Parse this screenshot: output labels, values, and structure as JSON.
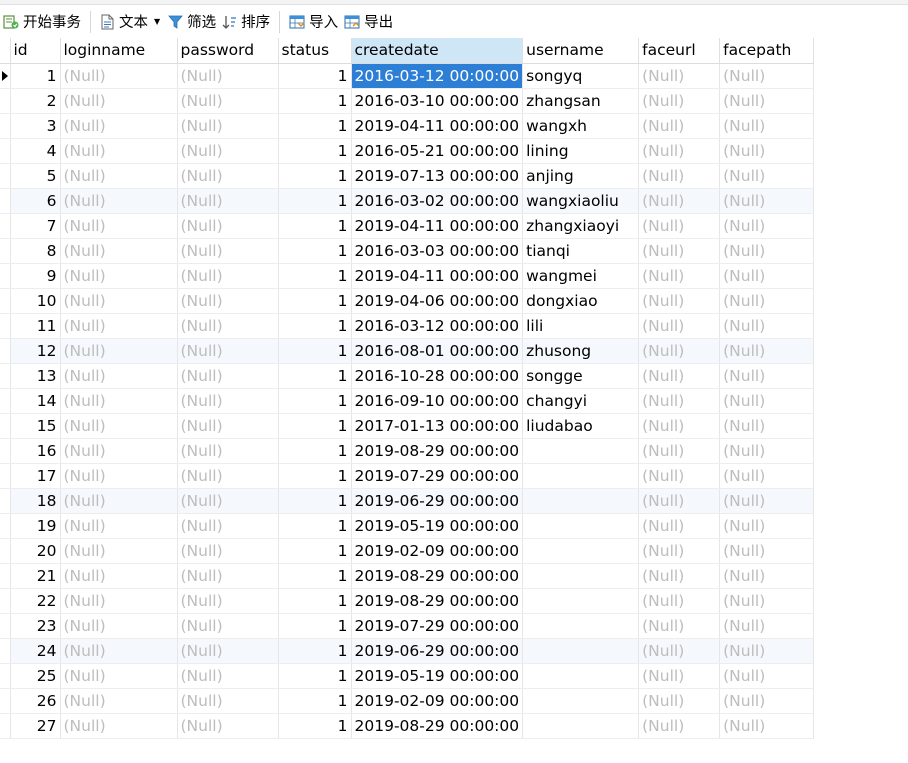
{
  "toolbar": {
    "begin_transaction": "开始事务",
    "text": "文本",
    "filter": "筛选",
    "sort": "排序",
    "import": "导入",
    "export": "导出"
  },
  "columns": [
    "id",
    "loginname",
    "password",
    "status",
    "createdate",
    "username",
    "faceurl",
    "facepath"
  ],
  "selected_column": "createdate",
  "null_text": "(Null)",
  "rows": [
    {
      "id": "1",
      "status": "1",
      "createdate": "2016-03-12 00:00:00",
      "username": "songyq"
    },
    {
      "id": "2",
      "status": "1",
      "createdate": "2016-03-10 00:00:00",
      "username": "zhangsan"
    },
    {
      "id": "3",
      "status": "1",
      "createdate": "2019-04-11 00:00:00",
      "username": "wangxh"
    },
    {
      "id": "4",
      "status": "1",
      "createdate": "2016-05-21 00:00:00",
      "username": "lining"
    },
    {
      "id": "5",
      "status": "1",
      "createdate": "2019-07-13 00:00:00",
      "username": "anjing"
    },
    {
      "id": "6",
      "status": "1",
      "createdate": "2016-03-02 00:00:00",
      "username": "wangxiaoliu"
    },
    {
      "id": "7",
      "status": "1",
      "createdate": "2019-04-11 00:00:00",
      "username": "zhangxiaoyi"
    },
    {
      "id": "8",
      "status": "1",
      "createdate": "2016-03-03 00:00:00",
      "username": "tianqi"
    },
    {
      "id": "9",
      "status": "1",
      "createdate": "2019-04-11 00:00:00",
      "username": "wangmei"
    },
    {
      "id": "10",
      "status": "1",
      "createdate": "2019-04-06 00:00:00",
      "username": "dongxiao"
    },
    {
      "id": "11",
      "status": "1",
      "createdate": "2016-03-12 00:00:00",
      "username": "lili"
    },
    {
      "id": "12",
      "status": "1",
      "createdate": "2016-08-01 00:00:00",
      "username": "zhusong"
    },
    {
      "id": "13",
      "status": "1",
      "createdate": "2016-10-28 00:00:00",
      "username": "songge"
    },
    {
      "id": "14",
      "status": "1",
      "createdate": "2016-09-10 00:00:00",
      "username": "changyi"
    },
    {
      "id": "15",
      "status": "1",
      "createdate": "2017-01-13 00:00:00",
      "username": "liudabao"
    },
    {
      "id": "16",
      "status": "1",
      "createdate": "2019-08-29 00:00:00",
      "username": ""
    },
    {
      "id": "17",
      "status": "1",
      "createdate": "2019-07-29 00:00:00",
      "username": ""
    },
    {
      "id": "18",
      "status": "1",
      "createdate": "2019-06-29 00:00:00",
      "username": ""
    },
    {
      "id": "19",
      "status": "1",
      "createdate": "2019-05-19 00:00:00",
      "username": ""
    },
    {
      "id": "20",
      "status": "1",
      "createdate": "2019-02-09 00:00:00",
      "username": ""
    },
    {
      "id": "21",
      "status": "1",
      "createdate": "2019-08-29 00:00:00",
      "username": ""
    },
    {
      "id": "22",
      "status": "1",
      "createdate": "2019-08-29 00:00:00",
      "username": ""
    },
    {
      "id": "23",
      "status": "1",
      "createdate": "2019-07-29 00:00:00",
      "username": ""
    },
    {
      "id": "24",
      "status": "1",
      "createdate": "2019-06-29 00:00:00",
      "username": ""
    },
    {
      "id": "25",
      "status": "1",
      "createdate": "2019-05-19 00:00:00",
      "username": ""
    },
    {
      "id": "26",
      "status": "1",
      "createdate": "2019-02-09 00:00:00",
      "username": ""
    },
    {
      "id": "27",
      "status": "1",
      "createdate": "2019-08-29 00:00:00",
      "username": ""
    }
  ],
  "alt_rows": [
    6,
    12,
    18,
    24
  ],
  "current_row": 1,
  "colors": {
    "selection": "#2d7fd6",
    "header_selected": "#cfe6f7",
    "null_text": "#bdbdbd",
    "alt_row": "#f5f9fd"
  }
}
